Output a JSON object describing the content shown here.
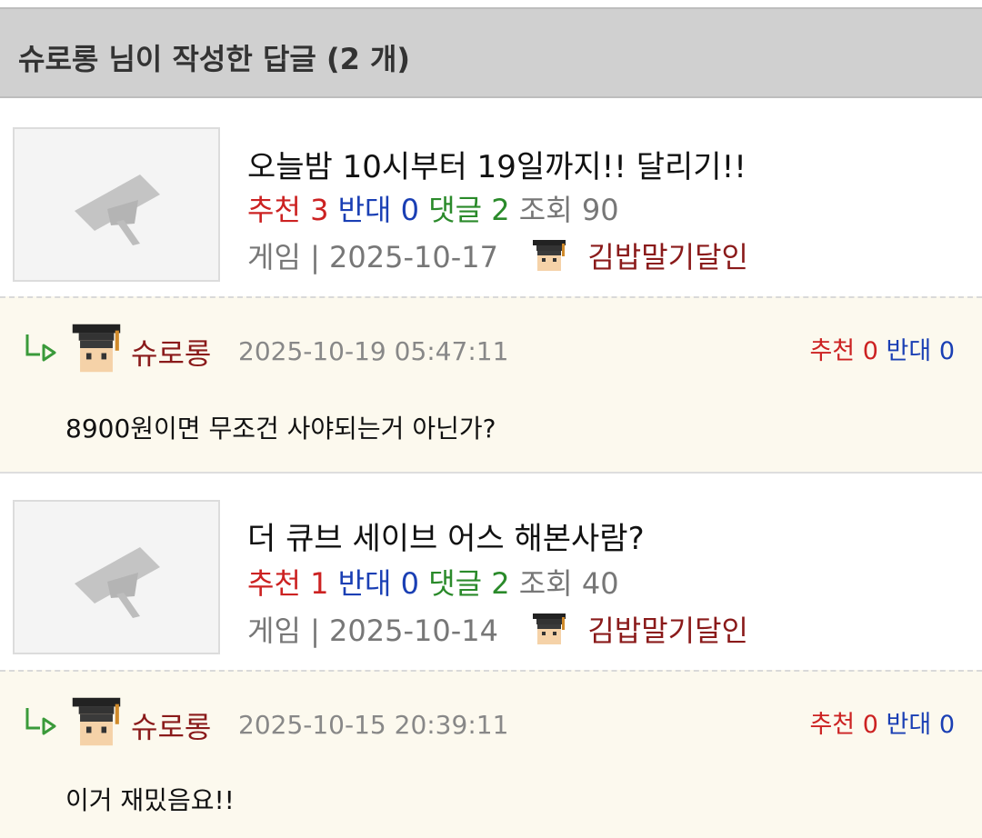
{
  "header": {
    "title": "슈로롱 님이 작성한 답글 (2 개)"
  },
  "posts": [
    {
      "title": "오늘밤 10시부터 19일까지!! 달리기!!",
      "recommend_label": "추천",
      "recommend": "3",
      "oppose_label": "반대",
      "oppose": "0",
      "comment_label": "댓글",
      "comments": "2",
      "view_label": "조회",
      "views": "90",
      "category": "게임",
      "separator": "|",
      "date": "2025-10-17",
      "author": "김밥말기달인",
      "reply": {
        "author": "슈로롱",
        "datetime": "2025-10-19 05:47:11",
        "recommend_label": "추천",
        "recommend": "0",
        "oppose_label": "반대",
        "oppose": "0",
        "text": "8900원이면 무조건 사야되는거 아닌가?"
      }
    },
    {
      "title": "더 큐브 세이브 어스 해본사람?",
      "recommend_label": "추천",
      "recommend": "1",
      "oppose_label": "반대",
      "oppose": "0",
      "comment_label": "댓글",
      "comments": "2",
      "view_label": "조회",
      "views": "40",
      "category": "게임",
      "separator": "|",
      "date": "2025-10-14",
      "author": "김밥말기달인",
      "reply": {
        "author": "슈로롱",
        "datetime": "2025-10-15 20:39:11",
        "recommend_label": "추천",
        "recommend": "0",
        "oppose_label": "반대",
        "oppose": "0",
        "text": "이거 재밌음요!!"
      }
    }
  ],
  "colors": {
    "recommend": "#cc2222",
    "oppose": "#1a3fb4",
    "comments": "#2a8a2a",
    "author": "#8a1a1a",
    "reply_bg": "#fcf9ee",
    "header_bg": "#d0d0d0"
  },
  "icons": {
    "thumbnail": "graduation-cap-icon",
    "avatar": "student-avatar-icon",
    "reply": "reply-arrow-icon"
  }
}
